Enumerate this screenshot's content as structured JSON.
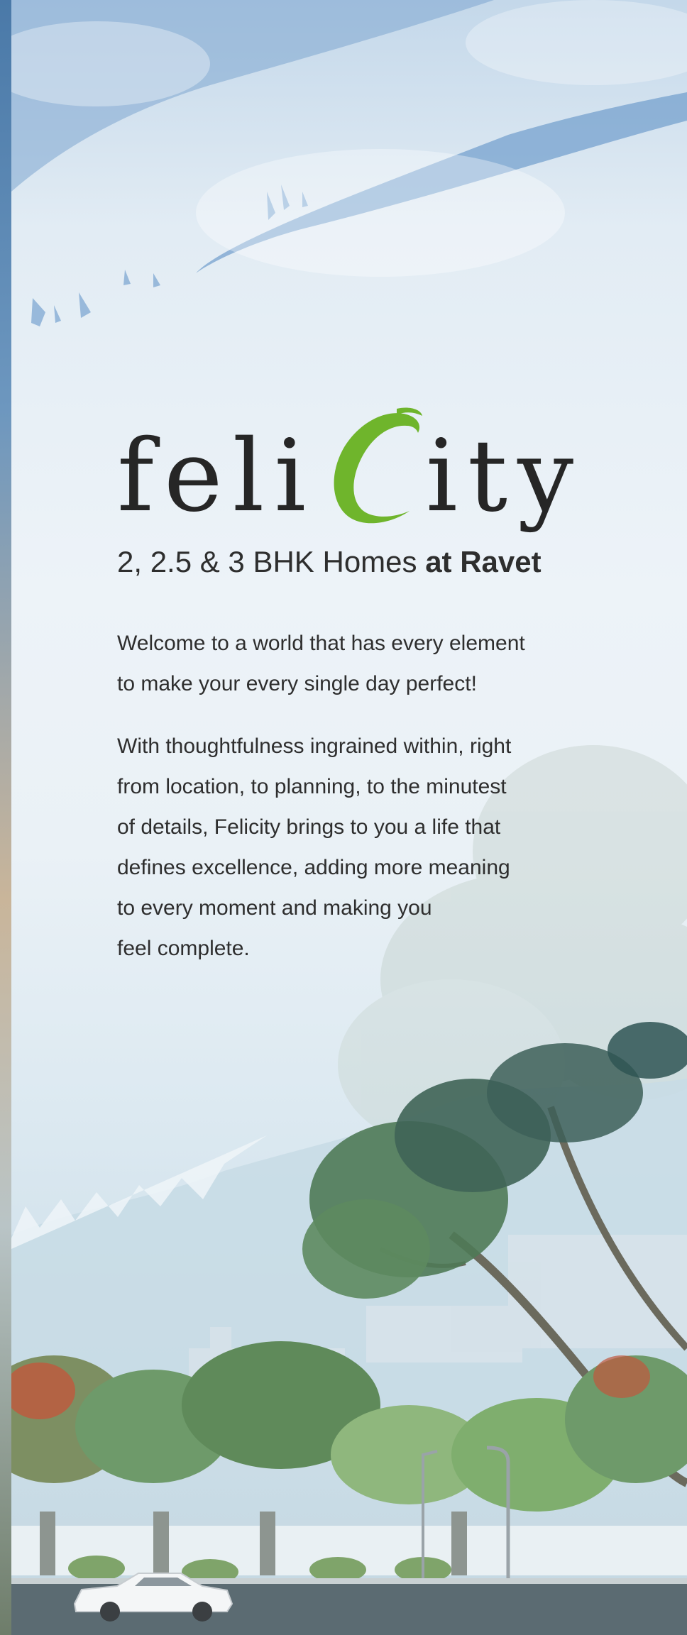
{
  "brand": {
    "logo_text": "feliCity",
    "logo_part1": "feli",
    "logo_part2": "ity",
    "logo_accent_color": "#6fb52c"
  },
  "hero": {
    "tagline_regular": "2, 2.5 & 3 BHK Homes ",
    "tagline_bold": "at Ravet"
  },
  "copy": {
    "paragraph1_line1": "Welcome to a world that has every element",
    "paragraph1_line2": "to make your every single day perfect!",
    "paragraph2_lines": [
      "With thoughtfulness ingrained within, right",
      "from location, to planning, to the minutest",
      "of details, Felicity brings to you a life that",
      "defines excellence, adding more meaning",
      "to every moment and making you",
      "feel complete."
    ]
  },
  "colors": {
    "text": "#2b2b2b",
    "sky": "#c4d8ea",
    "foliage": "#5f8a5a"
  }
}
